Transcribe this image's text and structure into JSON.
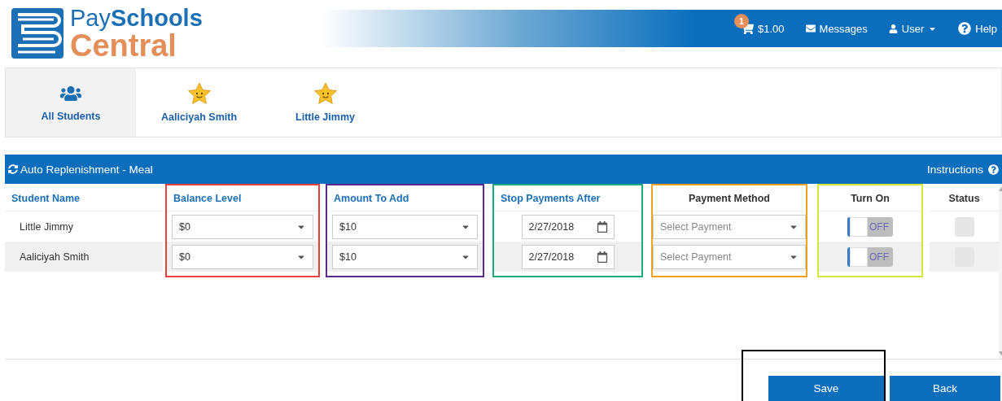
{
  "logo": {
    "pay": "Pay",
    "schools": "Schools",
    "central": "Central"
  },
  "topbar": {
    "cart_count": "1",
    "cart_total": "$1.00",
    "messages": "Messages",
    "user": "User",
    "help": "Help"
  },
  "student_tabs": [
    {
      "label": "All Students",
      "kind": "group",
      "selected": true
    },
    {
      "label": "Aaliciyah Smith",
      "kind": "student",
      "selected": false
    },
    {
      "label": "Little Jimmy",
      "kind": "student",
      "selected": false
    }
  ],
  "panel": {
    "title": "Auto Replenishment - Meal",
    "instructions": "Instructions"
  },
  "columns": [
    {
      "label": "Student Name",
      "kind": "text"
    },
    {
      "label": "Balance Level",
      "kind": "select",
      "color": "#e8413c"
    },
    {
      "label": "Amount To Add",
      "kind": "select",
      "color": "#5b2a8e"
    },
    {
      "label": "Stop Payments After",
      "kind": "date",
      "color": "#1faa7c"
    },
    {
      "label": "Payment Method",
      "kind": "method",
      "color": "#f0a020"
    },
    {
      "label": "Turn On",
      "kind": "toggle",
      "color": "#d4e83a"
    },
    {
      "label": "Status",
      "kind": "status"
    }
  ],
  "rows": [
    {
      "cells": [
        "Little Jimmy",
        "$0",
        "$10",
        "2/27/2018",
        {
          "placeholder": "Select Payment"
        },
        {
          "on": false,
          "label": "OFF"
        },
        {
          "checked": false
        }
      ]
    },
    {
      "cells": [
        "Aaliciyah Smith",
        "$0",
        "$10",
        "2/27/2018",
        {
          "placeholder": "Select Payment"
        },
        {
          "on": false,
          "label": "OFF"
        },
        {
          "checked": false
        }
      ]
    }
  ],
  "actions": [
    {
      "label": "Save",
      "color": "#000000"
    },
    {
      "label": "Back"
    }
  ]
}
